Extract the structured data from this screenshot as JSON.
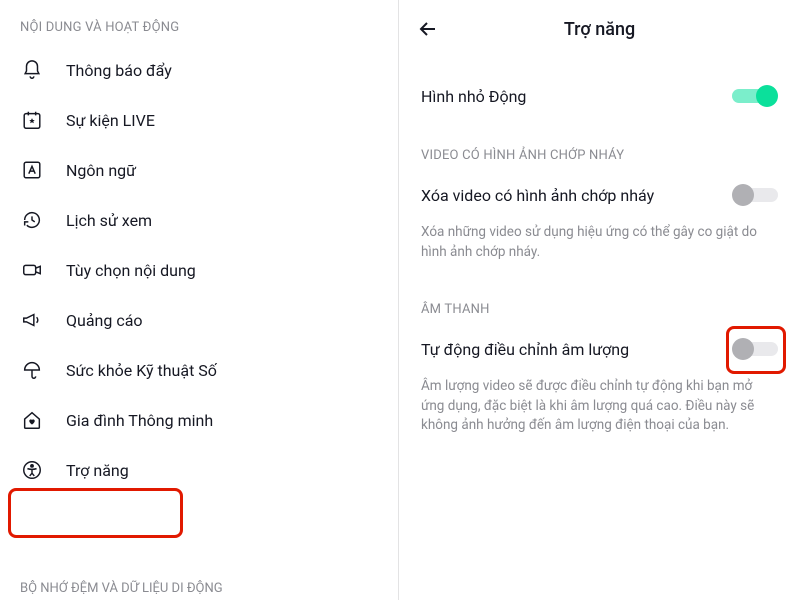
{
  "left": {
    "section_header": "NỘI DUNG VÀ HOẠT ĐỘNG",
    "items": [
      {
        "label": "Thông báo đẩy"
      },
      {
        "label": "Sự kiện LIVE"
      },
      {
        "label": "Ngôn ngữ"
      },
      {
        "label": "Lịch sử xem"
      },
      {
        "label": "Tùy chọn nội dung"
      },
      {
        "label": "Quảng cáo"
      },
      {
        "label": "Sức khỏe Kỹ thuật Số"
      },
      {
        "label": "Gia đình Thông minh"
      },
      {
        "label": "Trợ năng"
      }
    ],
    "bottom_header_partial": "BỘ NHỚ ĐỆM VÀ DỮ LIỆU DI ĐỘNG"
  },
  "right": {
    "title": "Trợ năng",
    "thumb_label": "Hình nhỏ Động",
    "group1_header": "VIDEO CÓ HÌNH ẢNH CHỚP NHÁY",
    "remove_flashing_label": "Xóa video có hình ảnh chớp nháy",
    "remove_flashing_desc": "Xóa những video sử dụng hiệu ứng có thể gây co giật do hình ảnh chớp nháy.",
    "group2_header": "ÂM THANH",
    "auto_volume_label": "Tự động điều chỉnh âm lượng",
    "auto_volume_desc": "Âm lượng video sẽ được điều chỉnh tự động khi bạn mở ứng dụng, đặc biệt là khi âm lượng quá cao. Điều này sẽ không ảnh hưởng đến âm lượng điện thoại của bạn."
  }
}
